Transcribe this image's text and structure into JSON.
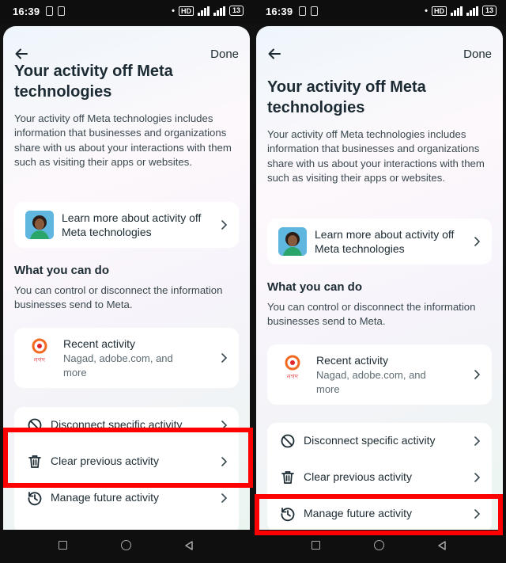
{
  "status_bar": {
    "time": "16:39",
    "battery": "13"
  },
  "header": {
    "done_label": "Done"
  },
  "page": {
    "title": "Your activity off Meta technologies",
    "description": "Your activity off Meta technologies includes information that businesses and organizations share with us about your interactions with them such as visiting their apps or websites.",
    "learn_more": "Learn more about activity off Meta technologies",
    "section_title": "What you can do",
    "section_description": "You can control or disconnect the information businesses send to Meta.",
    "recent_activity": {
      "title": "Recent activity",
      "subtitle": "Nagad, adobe.com, and more",
      "brand_text": "নগদ"
    },
    "actions": [
      {
        "label": "Disconnect specific activity",
        "icon": "prohibit-icon"
      },
      {
        "label": "Clear previous activity",
        "icon": "trash-icon"
      },
      {
        "label": "Manage future activity",
        "icon": "history-clock-icon"
      }
    ]
  },
  "annotations": {
    "left_highlight": "Clear previous activity",
    "right_highlight": "Manage future activity",
    "color": "#ff0000"
  }
}
